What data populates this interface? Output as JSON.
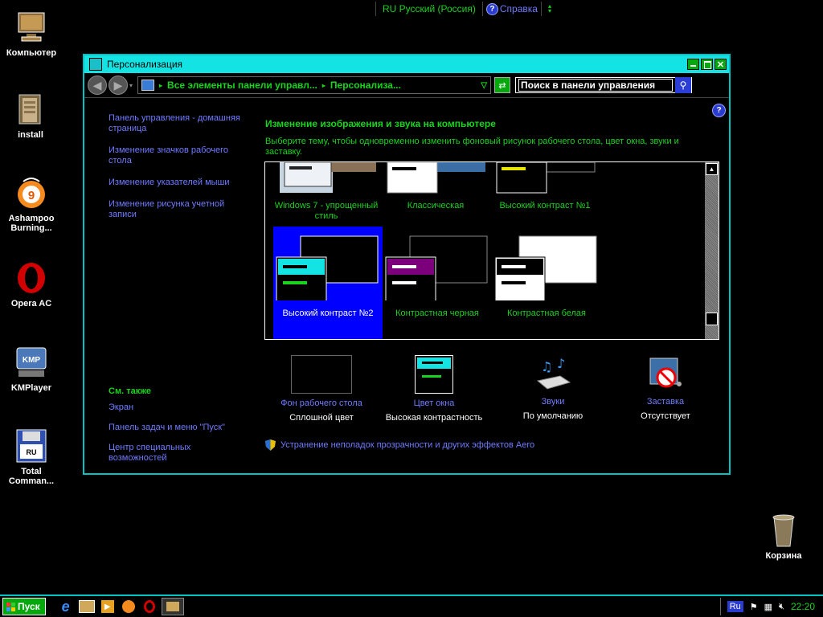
{
  "langbar": {
    "language": "RU Русский (Россия)",
    "help": "Справка"
  },
  "desktop_icons": [
    {
      "label": "Компьютер"
    },
    {
      "label": "install"
    },
    {
      "label": "Ashampoo Burning..."
    },
    {
      "label": "Opera AC"
    },
    {
      "label": "KMPlayer"
    },
    {
      "label": "Total Comman..."
    },
    {
      "label": "Корзина"
    }
  ],
  "window": {
    "title": "Персонализация",
    "breadcrumb": [
      "Все элементы панели управл...",
      "Персонализа..."
    ],
    "search_placeholder": "Поиск в панели управления",
    "left_links": [
      "Панель управления - домашняя страница",
      "Изменение значков рабочего стола",
      "Изменение указателей мыши",
      "Изменение рисунка учетной записи"
    ],
    "see_also": {
      "heading": "См. также",
      "links": [
        "Экран",
        "Панель задач и меню \"Пуск\"",
        "Центр специальных возможностей"
      ]
    },
    "main_title": "Изменение изображения и звука на компьютере",
    "main_desc": "Выберите тему, чтобы одновременно изменить фоновый рисунок рабочего стола, цвет окна, звуки и заставку.",
    "themes": [
      {
        "name": "Windows 7 - упрощенный стиль",
        "selected": false
      },
      {
        "name": "Классическая",
        "selected": false
      },
      {
        "name": "Высокий контраст №1",
        "selected": false
      },
      {
        "name": "Высокий контраст №2",
        "selected": true
      },
      {
        "name": "Контрастная черная",
        "selected": false
      },
      {
        "name": "Контрастная белая",
        "selected": false
      }
    ],
    "bottom_items": [
      {
        "link": "Фон рабочего стола",
        "value": "Сплошной цвет"
      },
      {
        "link": "Цвет окна",
        "value": "Высокая контрастность"
      },
      {
        "link": "Звуки",
        "value": "По умолчанию"
      },
      {
        "link": "Заставка",
        "value": "Отсутствует"
      }
    ],
    "aero_link": "Устранение неполадок прозрачности и других эффектов Aero"
  },
  "taskbar": {
    "start_label": "Пуск",
    "tray_lang": "Ru",
    "clock": "22:20"
  },
  "colors": {
    "accent": "#14e3e3",
    "link": "#6f7bff",
    "green": "#19d31e",
    "selection": "#0000ff"
  }
}
